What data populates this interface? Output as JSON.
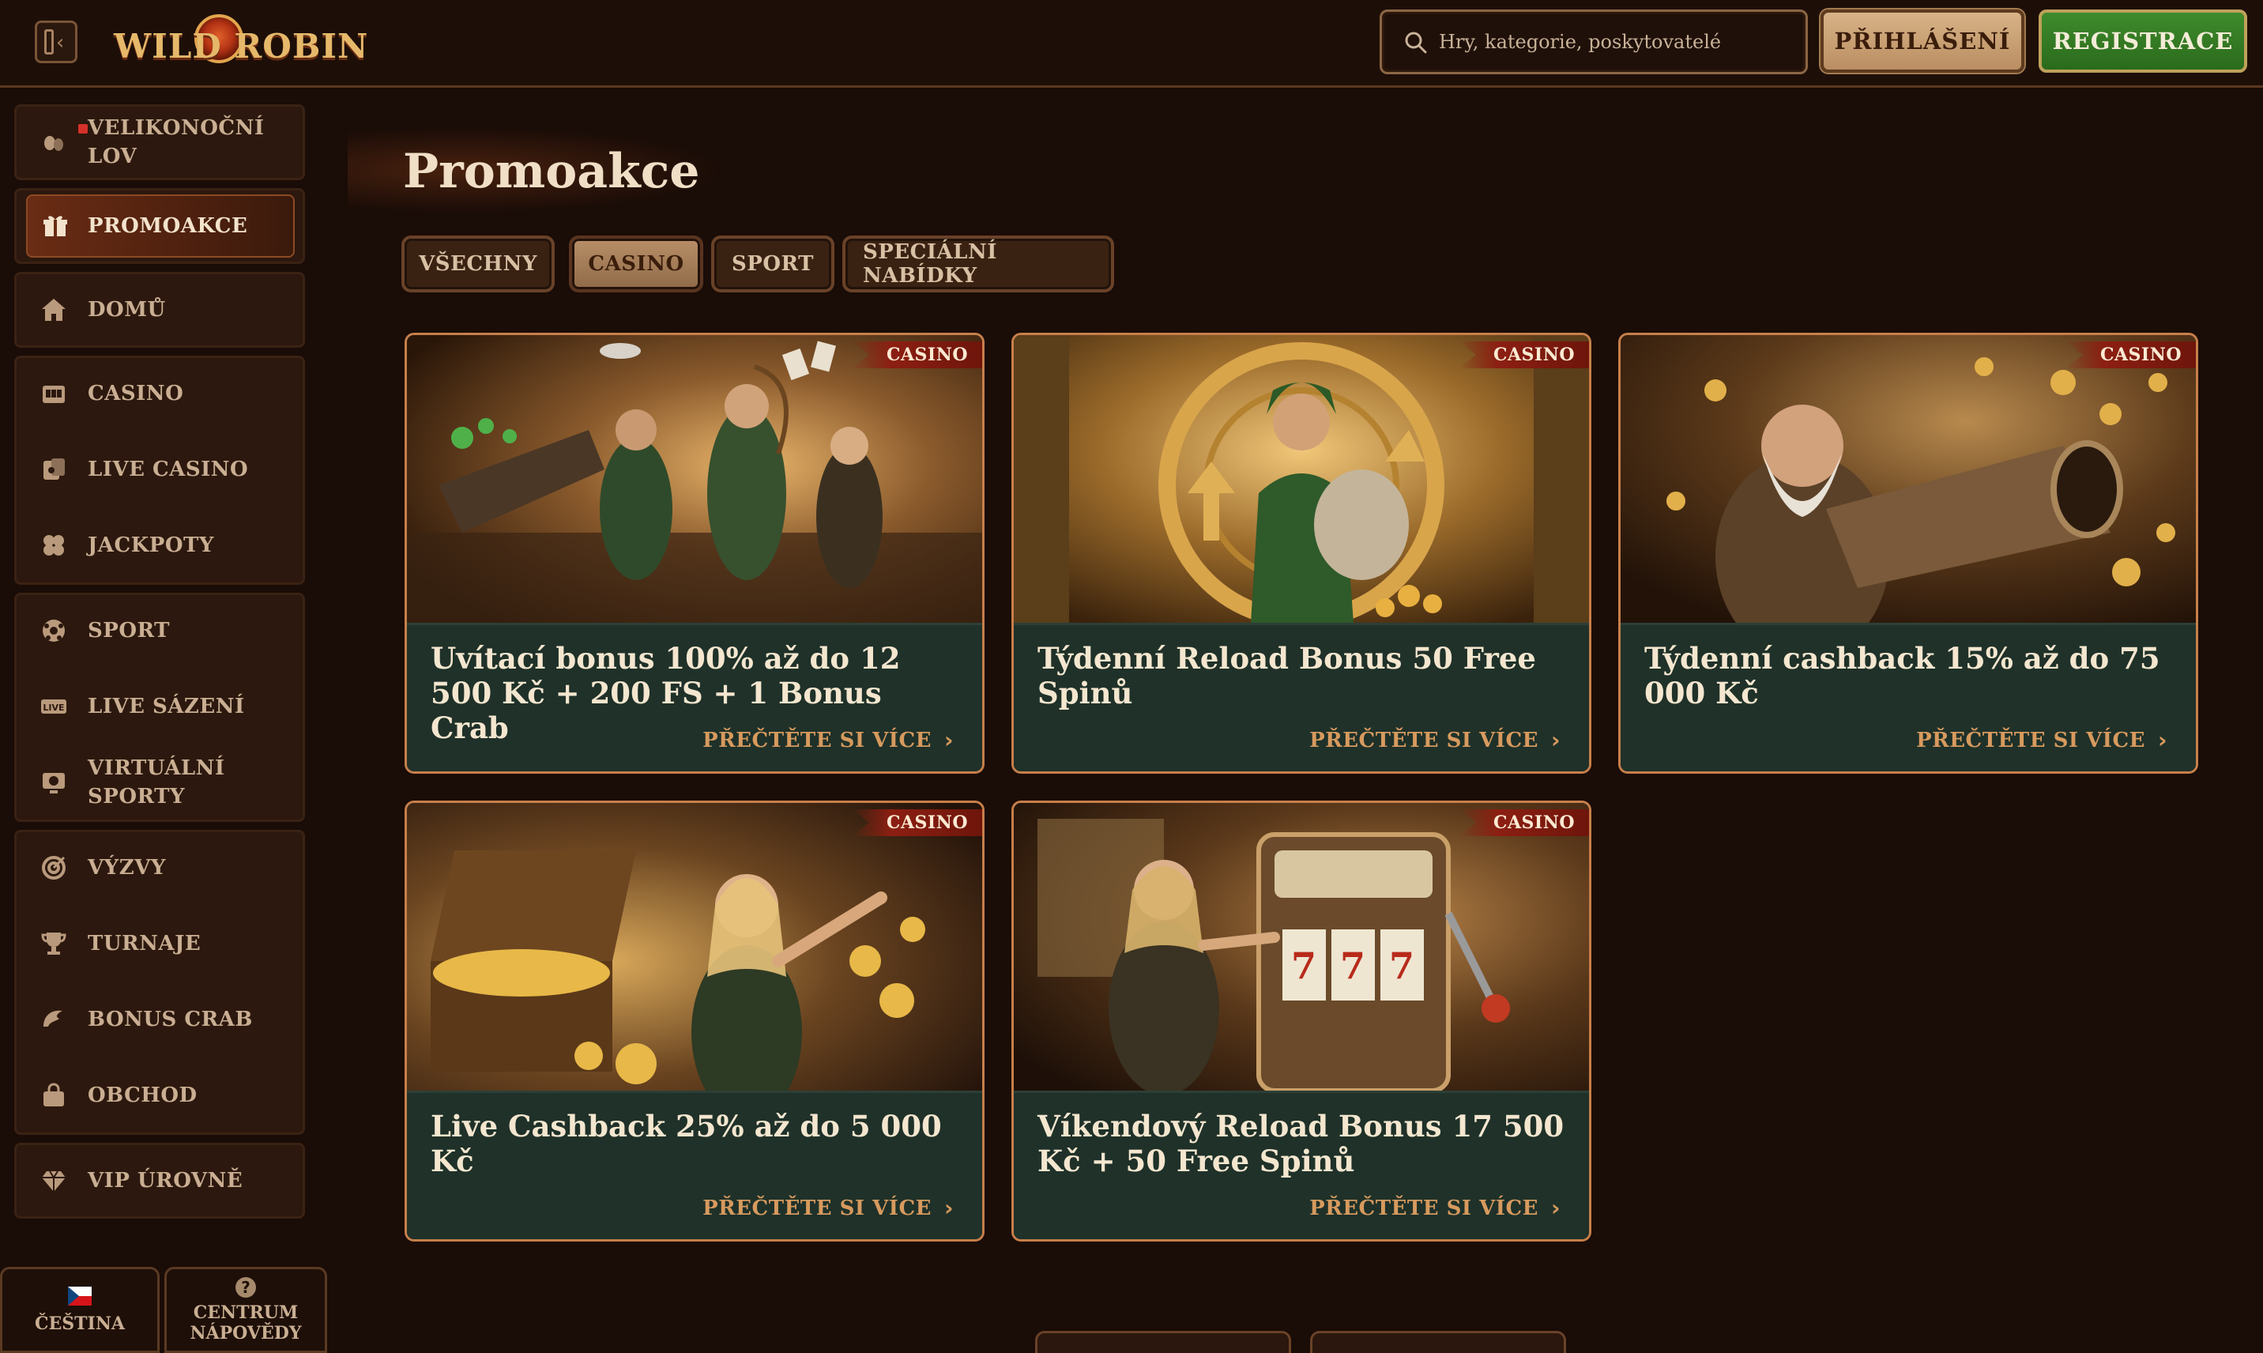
{
  "header": {
    "logo_text": "WILD ROBIN",
    "search_placeholder": "Hry, kategorie, poskytovatelé",
    "login_label": "PŘIHLÁŠENÍ",
    "register_label": "REGISTRACE"
  },
  "sidebar": {
    "items": [
      {
        "label": "VELIKONOČNÍ LOV",
        "icon": "eggs-icon"
      },
      {
        "label": "PROMOAKCE",
        "icon": "gift-icon",
        "active": true
      },
      {
        "label": "DOMŮ",
        "icon": "home-icon"
      },
      {
        "label": "CASINO",
        "icon": "slot-machine-icon"
      },
      {
        "label": "LIVE CASINO",
        "icon": "live-cards-icon"
      },
      {
        "label": "JACKPOTY",
        "icon": "clover-icon"
      },
      {
        "label": "SPORT",
        "icon": "soccer-ball-icon"
      },
      {
        "label": "LIVE SÁZENÍ",
        "icon": "live-badge-icon"
      },
      {
        "label": "VIRTUÁLNÍ SPORTY",
        "icon": "virtual-sports-icon"
      },
      {
        "label": "VÝZVY",
        "icon": "target-icon"
      },
      {
        "label": "TURNAJE",
        "icon": "trophy-icon"
      },
      {
        "label": "BONUS CRAB",
        "icon": "crab-claw-icon"
      },
      {
        "label": "OBCHOD",
        "icon": "shopping-bag-icon"
      },
      {
        "label": "VIP ÚROVNĚ",
        "icon": "diamond-icon"
      }
    ],
    "language_label": "ČEŠTINA",
    "help_label": "CENTRUM NÁPOVĚDY"
  },
  "main": {
    "title": "Promoakce",
    "tabs": [
      {
        "label": "VŠECHNY",
        "active": false
      },
      {
        "label": "CASINO",
        "active": true
      },
      {
        "label": "SPORT",
        "active": false
      },
      {
        "label": "SPECIÁLNÍ NABÍDKY",
        "active": false
      }
    ],
    "cards": [
      {
        "badge": "CASINO",
        "title": "Uvítací bonus 100% až do 12 500 Kč + 200 FS + 1 Bonus Crab",
        "cta": "PŘEČTĚTE SI VÍCE"
      },
      {
        "badge": "CASINO",
        "title": "Týdenní Reload Bonus 50 Free Spinů",
        "cta": "PŘEČTĚTE SI VÍCE"
      },
      {
        "badge": "CASINO",
        "title": "Týdenní cashback 15% až do 75 000 Kč",
        "cta": "PŘEČTĚTE SI VÍCE"
      },
      {
        "badge": "CASINO",
        "title": "Live Cashback 25% až do 5 000 Kč",
        "cta": "PŘEČTĚTE SI VÍCE"
      },
      {
        "badge": "CASINO",
        "title": "Víkendový Reload Bonus 17 500 Kč + 50 Free Spinů",
        "cta": "PŘEČTĚTE SI VÍCE"
      }
    ]
  },
  "colors": {
    "background": "#1a0c07",
    "card_body": "#1f3129",
    "card_border": "#c77f4a",
    "accent_orange": "#d79a5e",
    "register_green": "#3f8b2c",
    "badge_red": "#8c1f12"
  }
}
